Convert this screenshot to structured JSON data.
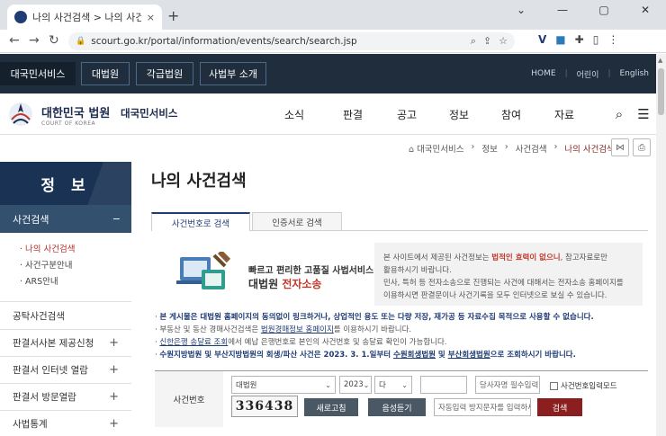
{
  "browser": {
    "tab_title": "나의 사건검색 > 나의 사건검",
    "url": "scourt.go.kr/portal/information/events/search/search.jsp",
    "close_tab_glyph": "×",
    "new_tab_glyph": "+",
    "window_buttons": [
      "⌄",
      "—",
      "▢",
      "✕"
    ]
  },
  "site_top": {
    "buttons": [
      "대국민서비스",
      "대법원",
      "각급법원",
      "사법부 소개"
    ],
    "links": [
      "HOME",
      "어린이",
      "English"
    ]
  },
  "header": {
    "logo_main": "대한민국 법원",
    "logo_sub": "COURT OF KOREA",
    "service_name": "대국민서비스",
    "menu": [
      "소식",
      "판결",
      "공고",
      "정보",
      "참여",
      "자료"
    ]
  },
  "breadcrumb": [
    "대국민서비스",
    "정보",
    "사건검색",
    "나의 사건검색"
  ],
  "sidebar": {
    "title": "정 보",
    "active_label": "사건검색",
    "active_toggle": "−",
    "sub_items": [
      "나의 사건검색",
      "사건구분안내",
      "ARS안내"
    ],
    "items": [
      {
        "label": "공탁사건검색",
        "toggle": ""
      },
      {
        "label": "판결서사본 제공신청",
        "toggle": "+"
      },
      {
        "label": "판결서 인터넷 열람",
        "toggle": "+"
      },
      {
        "label": "판결서 방문열람",
        "toggle": "+"
      },
      {
        "label": "사법통계",
        "toggle": "+"
      }
    ]
  },
  "content": {
    "title": "나의 사건검색",
    "tabs": [
      "사건번호로 검색",
      "인증서로 검색"
    ],
    "banner": {
      "line1": "빠르고 편리한 고품질 사법서비스",
      "line2_a": "대법원",
      "line2_b": "전자소송",
      "desc_1a": "본 사이트에서 제공된 사건정보는 ",
      "desc_1b": "법적인 효력이 없으니",
      "desc_1c": ", 참고자료로만",
      "desc_2": "활용하시기 바랍니다.",
      "desc_3": "민사, 특허 등 전자소송으로 진행되는 사건에 대해서는 전자소송 홈페이지를",
      "desc_4": "이용하시면 판결문이나 사건기록을 모두 인터넷으로 보실 수 있습니다."
    },
    "notes": {
      "n1": "본 게시물은 대법원 홈페이지의 동의없이 링크하거나, 상업적인 용도 또는 다량 저장, 재가공 등 자료수집 목적으로 사용할 수 없습니다.",
      "n2a": "부동산 및 동산 경매사건검색은 ",
      "n2b": "법원경매정보 홈페이지",
      "n2c": "를 이용하시기 바랍니다.",
      "n3a": "신한은행 송달료 조회",
      "n3b": "에서 예납 은행번호로 본인의 사건번호 및 송달료 확인이 가능합니다.",
      "n4a": "수원지방법원 및 부산지방법원의 회생/파산 사건은 2023. 3. 1.일부터 ",
      "n4b": "수원회생법원",
      "n4c": " 및 ",
      "n4d": "부산회생법원",
      "n4e": "으로 조회하시기 바랍니다."
    },
    "form": {
      "label": "사건번호",
      "court": "대법원",
      "year": "2023",
      "case_type": "다",
      "case_number": "",
      "party_placeholder": "당사자명 필수입력",
      "case_input_checkbox": "사건번호입력모드",
      "captcha_text": "336438",
      "refresh_button": "새로고침",
      "audio_button": "음성듣기",
      "captcha_placeholder": "자동입력 방지문자를 입력하세요",
      "search_button": "검색"
    }
  },
  "colors": {
    "navy": "#1f2d3d",
    "side_navy": "#1a3354",
    "accent_red": "#c0392b",
    "search_red": "#8b1e1e"
  }
}
